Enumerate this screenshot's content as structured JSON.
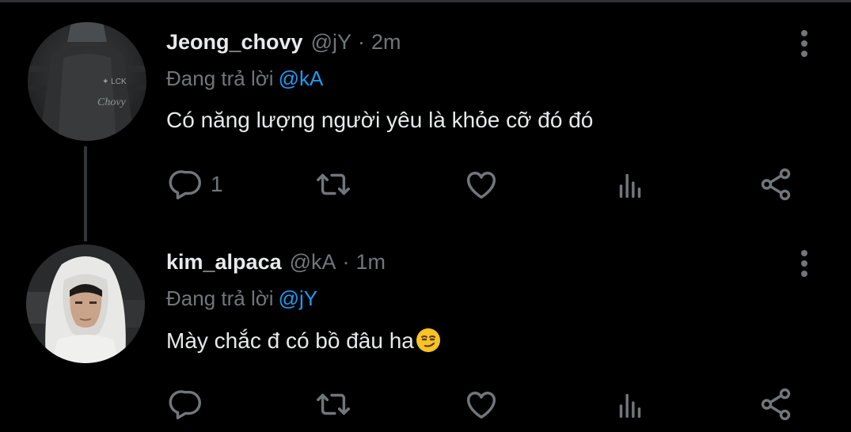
{
  "colors": {
    "background": "#000000",
    "text": "#e7e9ea",
    "muted": "#71767b",
    "accent": "#1d9bf0",
    "thread_line": "#333639"
  },
  "tweets": [
    {
      "name": "Jeong_chovy",
      "handle": "@jY",
      "separator": "·",
      "time": "2m",
      "reply_prefix": "Đang trả lời",
      "reply_to": "@kA",
      "text": "Có năng lượng người yêu là khỏe cỡ đó đó",
      "reply_count": "1",
      "avatar": "avatar-black-jersey-chovy",
      "avatar_jersey_text": "Chovy"
    },
    {
      "name": "kim_alpaca",
      "handle": "@kA",
      "separator": "·",
      "time": "1m",
      "reply_prefix": "Đang trả lời",
      "reply_to": "@jY",
      "text": "Mày chắc đ có bồ đâu ha",
      "emoji": "smirking-face-emoji",
      "reply_count": "",
      "avatar": "avatar-white-hoodie"
    }
  ],
  "icons": [
    "more-vertical-icon",
    "reply-icon",
    "retweet-icon",
    "like-icon",
    "views-icon",
    "share-icon"
  ]
}
